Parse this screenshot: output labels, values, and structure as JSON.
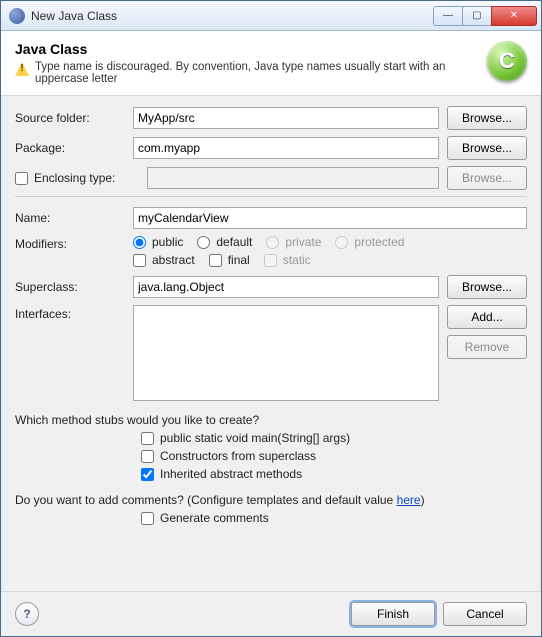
{
  "window": {
    "title": "New Java Class"
  },
  "header": {
    "title": "Java Class",
    "warning": "Type name is discouraged. By convention, Java type names usually start with an uppercase letter",
    "iconLetter": "C"
  },
  "labels": {
    "sourceFolder": "Source folder:",
    "package": "Package:",
    "enclosingType": "Enclosing type:",
    "name": "Name:",
    "modifiers": "Modifiers:",
    "superclass": "Superclass:",
    "interfaces": "Interfaces:"
  },
  "fields": {
    "sourceFolder": "MyApp/src",
    "package": "com.myapp",
    "enclosingType": "",
    "name": "myCalendarView",
    "superclass": "java.lang.Object"
  },
  "buttons": {
    "browse": "Browse...",
    "add": "Add...",
    "remove": "Remove",
    "finish": "Finish",
    "cancel": "Cancel"
  },
  "modifiers": {
    "public": "public",
    "default": "default",
    "private": "private",
    "protected": "protected",
    "abstract": "abstract",
    "final": "final",
    "static": "static"
  },
  "stubs": {
    "question": "Which method stubs would you like to create?",
    "main": "public static void main(String[] args)",
    "constructors": "Constructors from superclass",
    "inherited": "Inherited abstract methods"
  },
  "comments": {
    "questionPrefix": "Do you want to add comments? (Configure templates and default value ",
    "hereLink": "here",
    "questionSuffix": ")",
    "generate": "Generate comments"
  }
}
